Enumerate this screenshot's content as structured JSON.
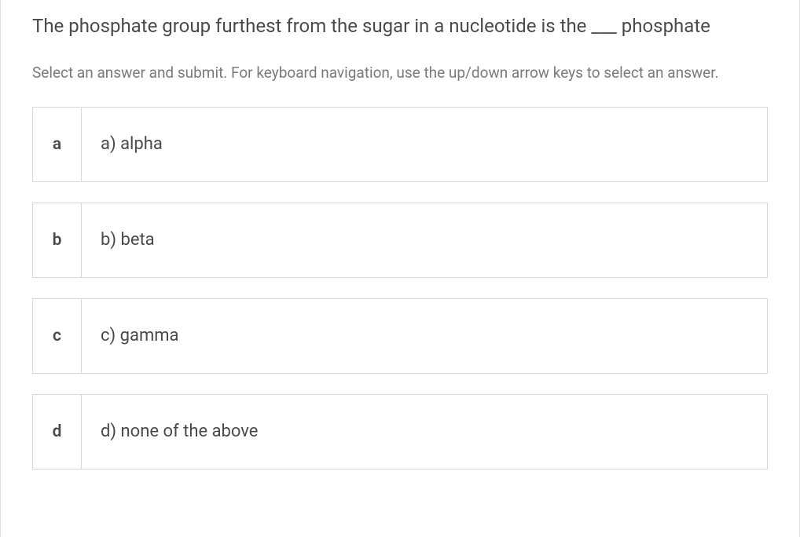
{
  "question": "The phosphate group furthest from the sugar in a nucleotide is the ___ phosphate",
  "instruction": "Select an answer and submit. For keyboard navigation, use the up/down arrow keys to select an answer.",
  "options": [
    {
      "key": "a",
      "text": "a) alpha"
    },
    {
      "key": "b",
      "text": "b) beta"
    },
    {
      "key": "c",
      "text": "c) gamma"
    },
    {
      "key": "d",
      "text": "d) none of the above"
    }
  ]
}
